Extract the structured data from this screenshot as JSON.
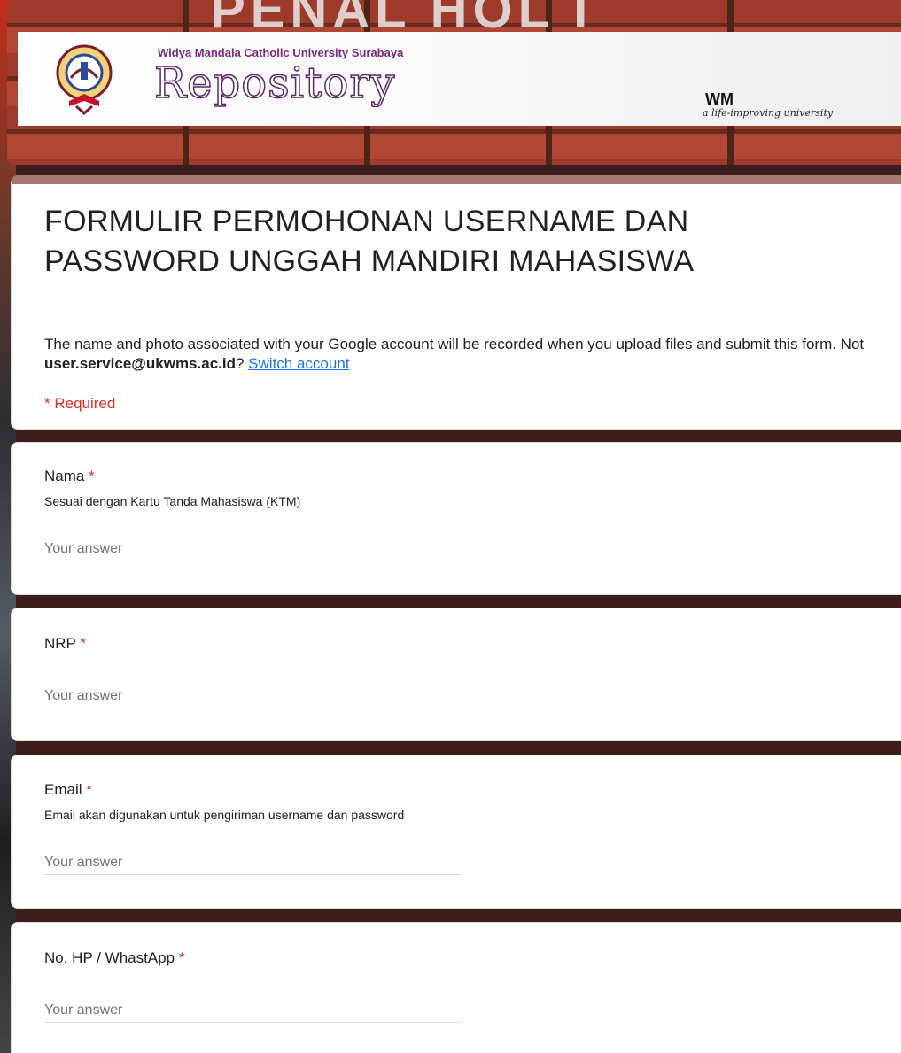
{
  "banner": {
    "university": "Widya Mandala Catholic University Surabaya",
    "title": "Repository",
    "logo_text": "WM",
    "tagline": "a life-improving university",
    "top_letters": "PENAL HOL I"
  },
  "form": {
    "title": "FORMULIR PERMOHONAN USERNAME DAN PASSWORD UNGGAH MANDIRI MAHASISWA",
    "notice_text": "The name and photo associated with your Google account will be recorded when you upload files and submit this form. Not ",
    "account_email": "user.service@ukwms.ac.id",
    "notice_suffix": "? ",
    "switch_account": "Switch account",
    "required_note": "* Required"
  },
  "questions": [
    {
      "label": "Nama",
      "required_mark": " *",
      "help": "Sesuai dengan Kartu Tanda Mahasiswa (KTM)",
      "placeholder": "Your answer"
    },
    {
      "label": "NRP",
      "required_mark": " *",
      "help": "",
      "placeholder": "Your answer"
    },
    {
      "label": "Email",
      "required_mark": " *",
      "help": "Email akan digunakan untuk pengiriman username dan password",
      "placeholder": "Your answer"
    },
    {
      "label": "No. HP / WhastApp",
      "required_mark": " *",
      "help": "",
      "placeholder": "Your answer"
    }
  ],
  "colors": {
    "accent": "#a4776f",
    "link": "#1a73e8",
    "required": "#d93025",
    "brick": "#9e3a2b"
  }
}
